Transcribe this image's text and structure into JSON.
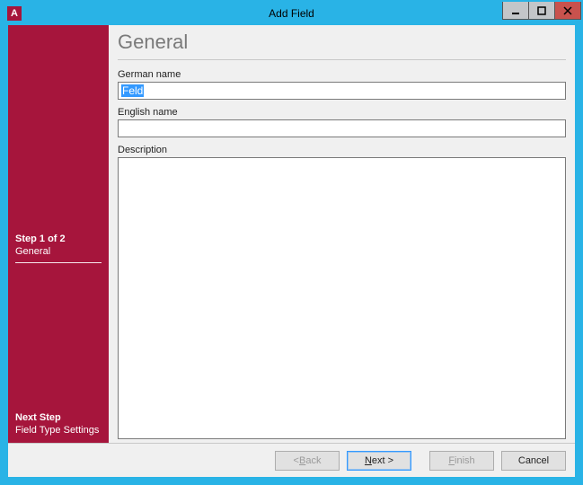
{
  "window": {
    "title": "Add Field",
    "app_icon_letter": "A"
  },
  "sidebar": {
    "step_title": "Step 1 of 2",
    "step_name": "General",
    "next_title": "Next Step",
    "next_name": "Field Type Settings"
  },
  "main": {
    "page_title": "General",
    "german_label": "German name",
    "german_value": "Feld",
    "english_label": "English name",
    "english_value": "",
    "description_label": "Description",
    "description_value": ""
  },
  "buttons": {
    "back_prefix": "< ",
    "back_mn": "B",
    "back_suffix": "ack",
    "next_mn": "N",
    "next_suffix": "ext >",
    "finish_prefix": "",
    "finish_mn": "F",
    "finish_suffix": "inish",
    "cancel": "Cancel"
  }
}
